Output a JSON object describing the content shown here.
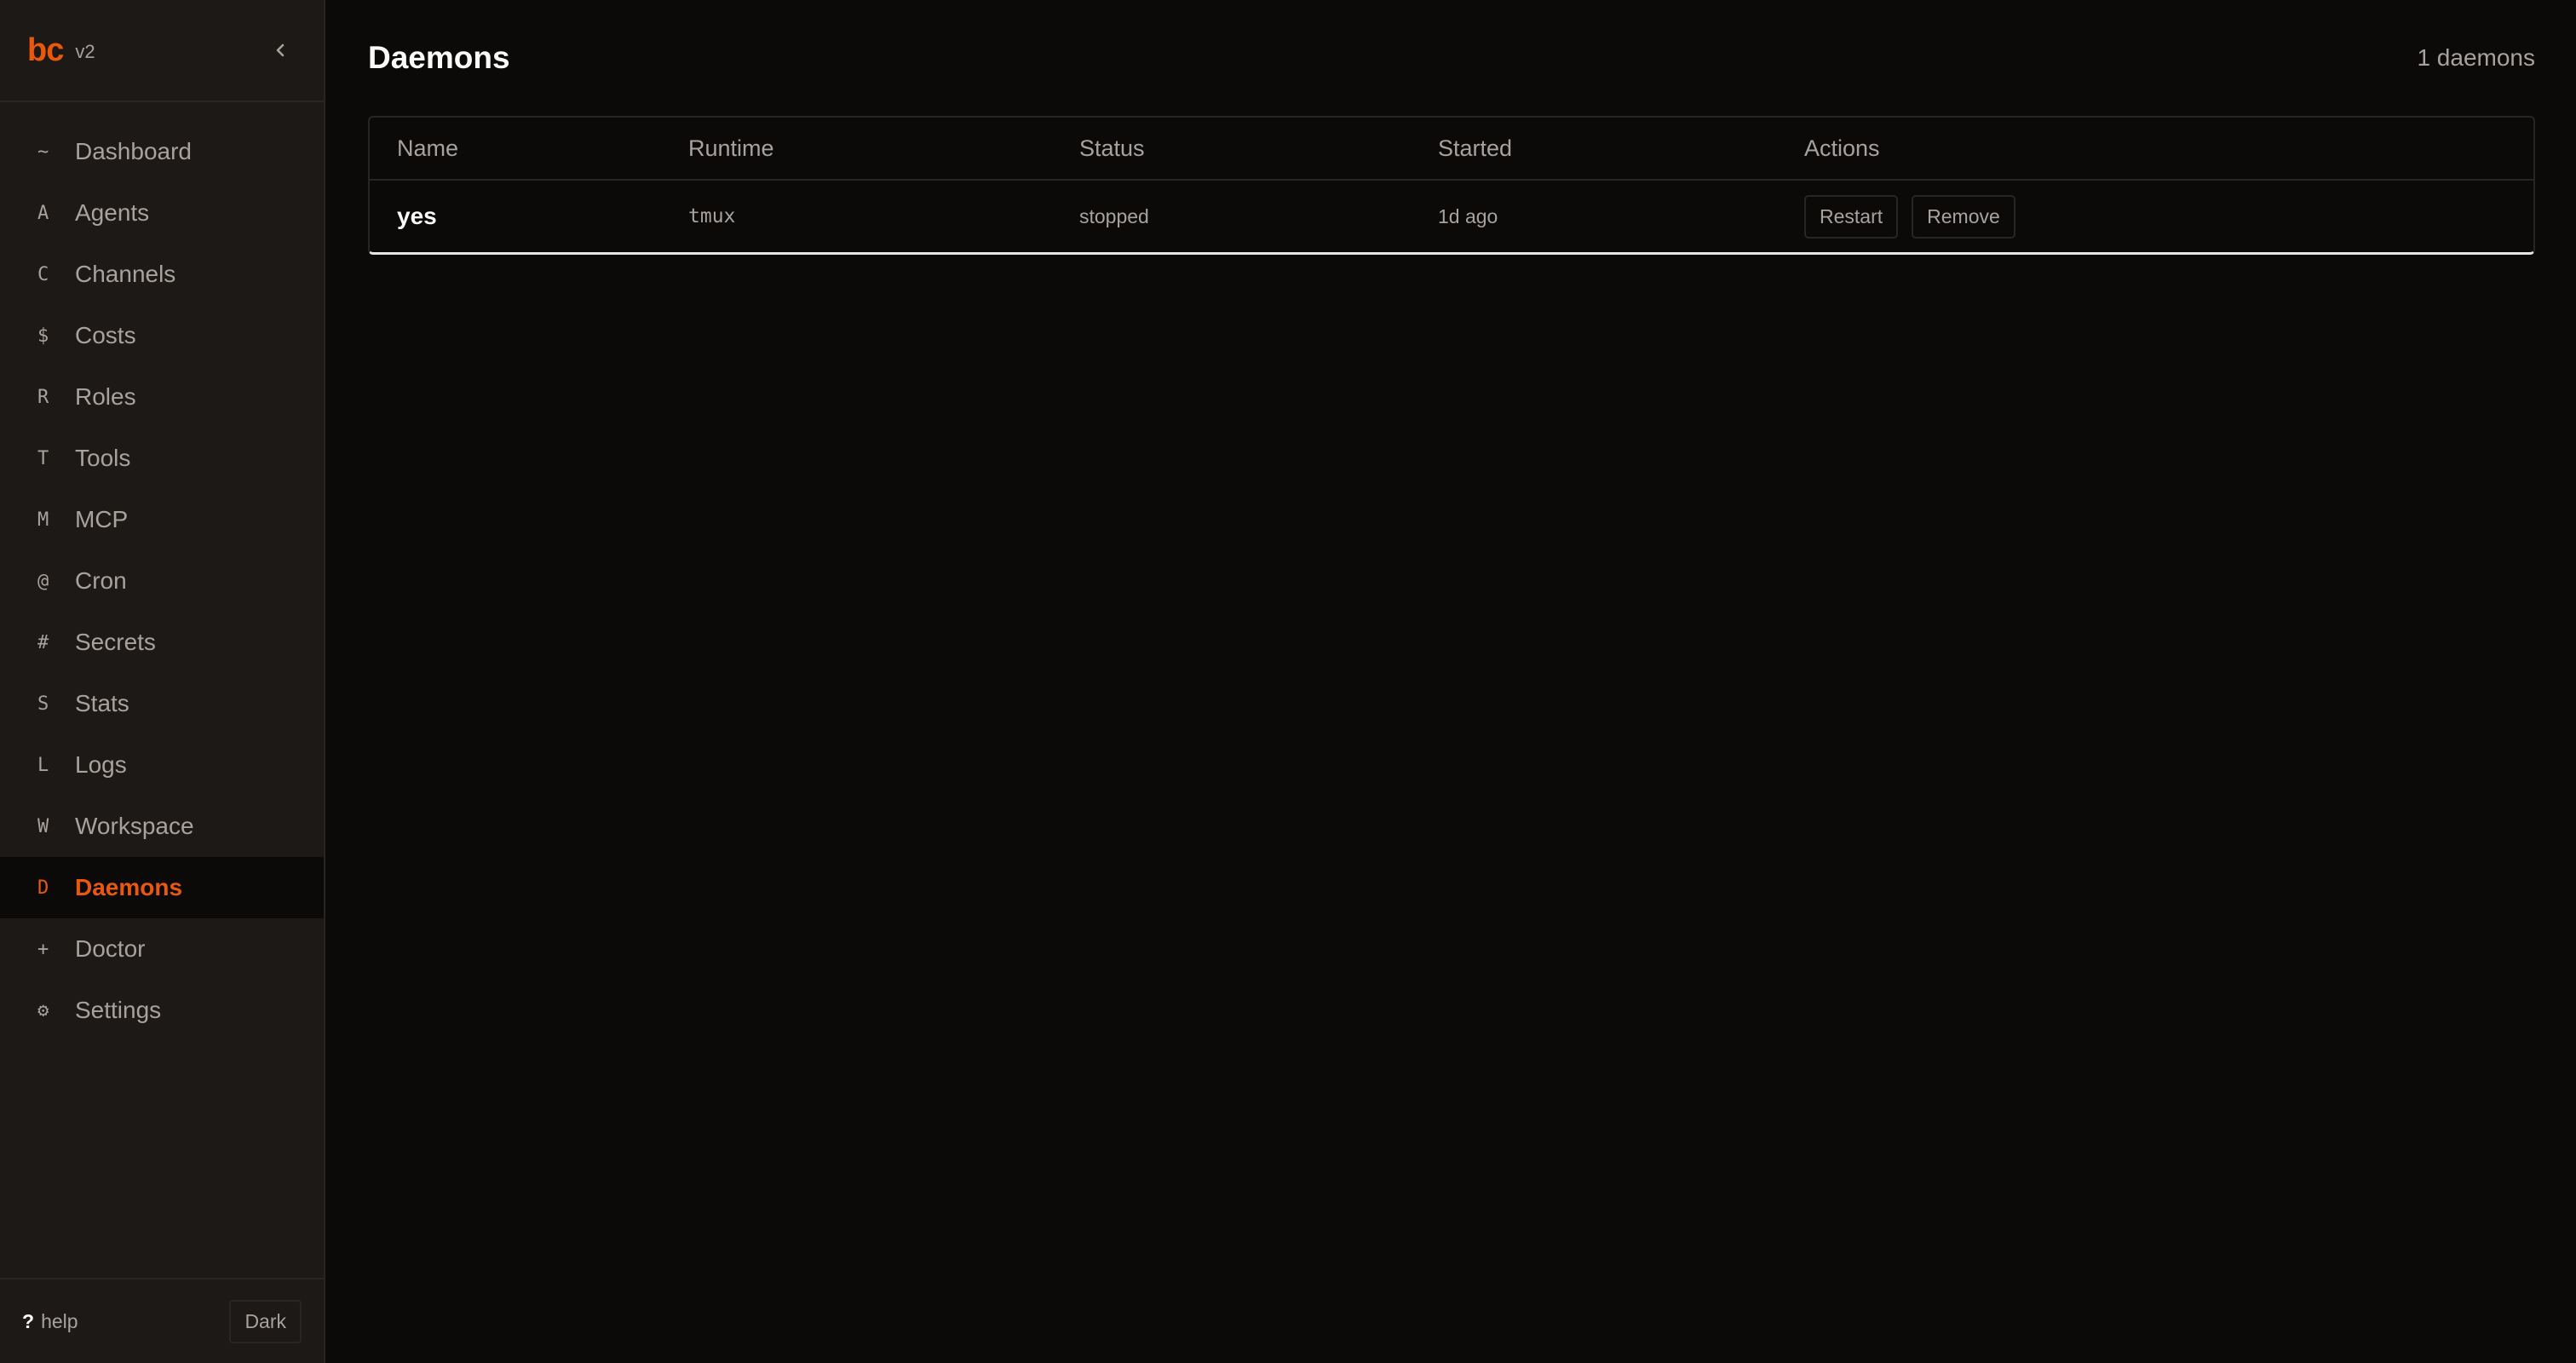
{
  "brand": {
    "logo": "bc",
    "version": "v2"
  },
  "sidebar": {
    "items": [
      {
        "letter": "~",
        "label": "Dashboard"
      },
      {
        "letter": "A",
        "label": "Agents"
      },
      {
        "letter": "C",
        "label": "Channels"
      },
      {
        "letter": "$",
        "label": "Costs"
      },
      {
        "letter": "R",
        "label": "Roles"
      },
      {
        "letter": "T",
        "label": "Tools"
      },
      {
        "letter": "M",
        "label": "MCP"
      },
      {
        "letter": "@",
        "label": "Cron"
      },
      {
        "letter": "#",
        "label": "Secrets"
      },
      {
        "letter": "S",
        "label": "Stats"
      },
      {
        "letter": "L",
        "label": "Logs"
      },
      {
        "letter": "W",
        "label": "Workspace"
      },
      {
        "letter": "D",
        "label": "Daemons",
        "active": true
      },
      {
        "letter": "+",
        "label": "Doctor"
      },
      {
        "letter": "⚙",
        "label": "Settings"
      }
    ],
    "footer": {
      "help_icon": "?",
      "help_label": "help",
      "theme_label": "Dark"
    }
  },
  "main": {
    "title": "Daemons",
    "count": "1 daemons",
    "table": {
      "headers": [
        "Name",
        "Runtime",
        "Status",
        "Started",
        "Actions"
      ],
      "rows": [
        {
          "name": "yes",
          "runtime": "tmux",
          "status": "stopped",
          "started": "1d ago",
          "actions": [
            "Restart",
            "Remove"
          ]
        }
      ]
    }
  },
  "colors": {
    "accent": "#ea580c",
    "background": "#0c0a09",
    "sidebar_bg": "#1c1917",
    "border": "#292524",
    "text_muted": "#a8a29e",
    "text_strong": "#fafaf9"
  },
  "icons": {
    "collapse": "chevron-left-icon"
  }
}
